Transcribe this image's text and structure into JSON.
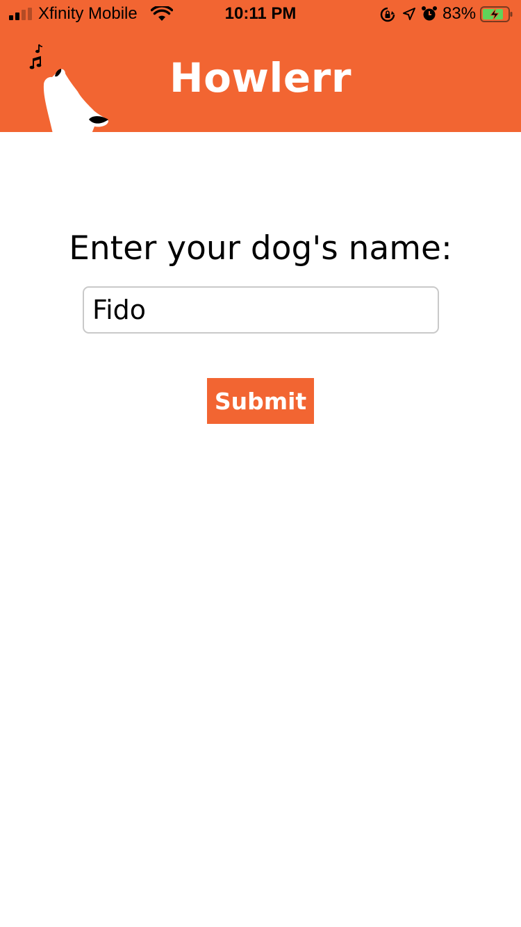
{
  "status_bar": {
    "carrier": "Xfinity Mobile",
    "time": "10:11 PM",
    "battery_percent": "83%",
    "battery_level": 0.83,
    "icons": [
      "signal-icon",
      "wifi-icon",
      "rotation-lock-icon",
      "location-icon",
      "alarm-icon",
      "battery-charging-icon"
    ]
  },
  "header": {
    "title": "Howlerr",
    "logo": "howling-dog-icon"
  },
  "form": {
    "prompt": "Enter your dog's name:",
    "name_value": "Fido",
    "submit_label": "Submit"
  },
  "colors": {
    "brand": "#f26532",
    "background": "#ffffff",
    "input_border": "#c9c9c9"
  }
}
